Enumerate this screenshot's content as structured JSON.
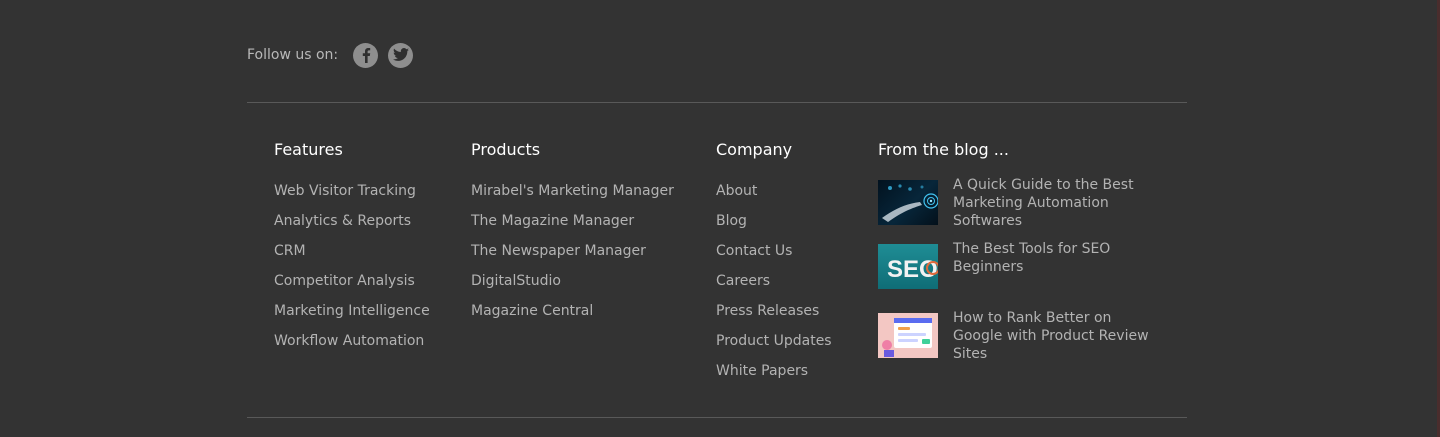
{
  "social": {
    "follow_label": "Follow us on:",
    "icons": [
      "facebook-icon",
      "twitter-icon"
    ]
  },
  "columns": {
    "features": {
      "heading": "Features",
      "items": [
        "Web Visitor Tracking",
        "Analytics & Reports",
        "CRM",
        "Competitor Analysis",
        "Marketing Intelligence",
        "Workflow Automation"
      ]
    },
    "products": {
      "heading": "Products",
      "items": [
        "Mirabel's Marketing Manager",
        "The Magazine Manager",
        "The Newspaper Manager",
        "DigitalStudio",
        "Magazine Central"
      ]
    },
    "company": {
      "heading": "Company",
      "items": [
        "About",
        "Blog",
        "Contact Us",
        "Careers",
        "Press Releases",
        "Product Updates",
        "White Papers"
      ]
    }
  },
  "blog": {
    "heading": "From the blog ...",
    "posts": [
      {
        "title": "A Quick Guide to the Best Marketing Automation Softwares",
        "thumb_text": ""
      },
      {
        "title": "The Best Tools for SEO Beginners",
        "thumb_text": "SEO"
      },
      {
        "title": "How to Rank Better on Google with Product Review Sites",
        "thumb_text": ""
      }
    ]
  },
  "colors": {
    "background": "#333333",
    "heading": "#ffffff",
    "link": "#b3b3b3",
    "divider": "#595959",
    "social_icon_bg": "#8e8e8e"
  }
}
